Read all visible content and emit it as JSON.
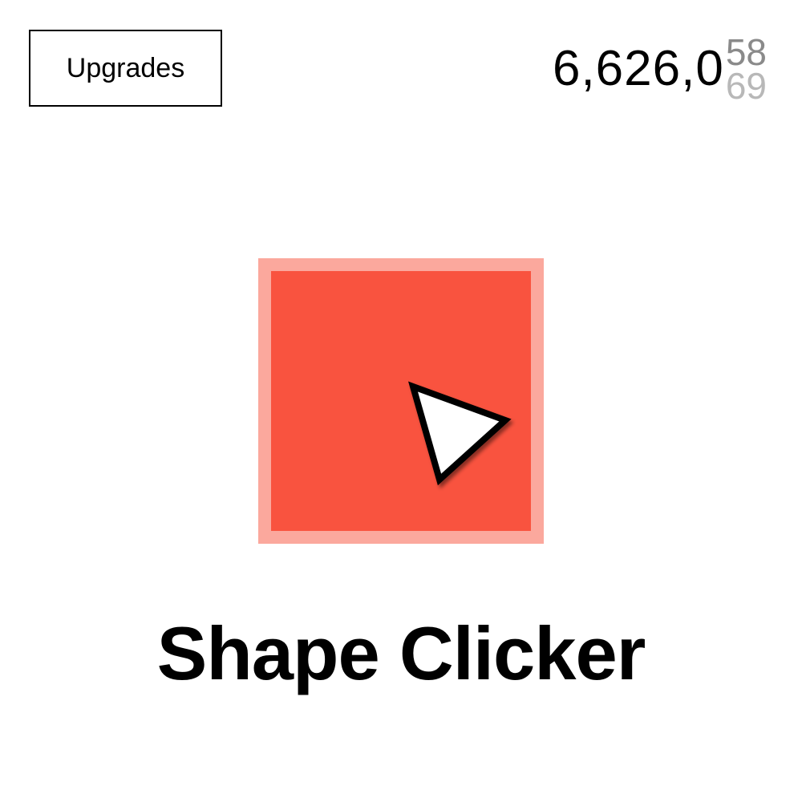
{
  "header": {
    "upgrades_label": "Upgrades"
  },
  "score": {
    "digits": "6,626,0",
    "rolling_top": "58",
    "rolling_bottom": "69"
  },
  "shape": {
    "kind": "square",
    "fill_color": "#f9533f",
    "border_color": "#fba89d",
    "cursor_icon": "arrow-cursor-icon"
  },
  "game": {
    "title": "Shape Clicker"
  }
}
